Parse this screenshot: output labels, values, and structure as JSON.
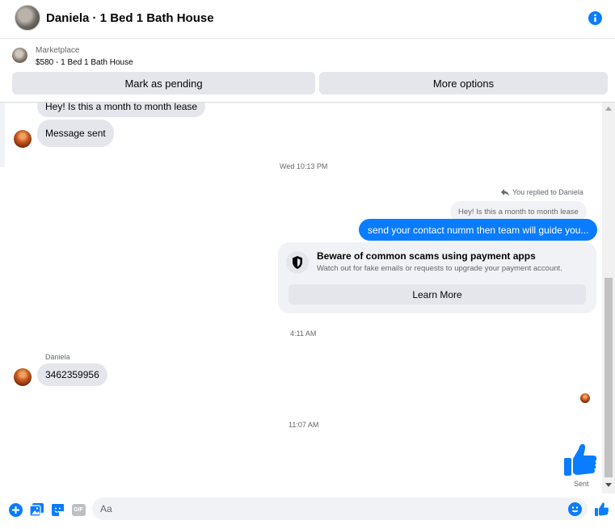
{
  "header": {
    "contact_name_title": "Daniela · 1 Bed 1 Bath House",
    "avatar_icon": "profile-photo",
    "info_icon": "info-icon"
  },
  "marketplace": {
    "label": "Marketplace",
    "listing": "$580 - 1 Bed 1 Bath House",
    "mark_pending_label": "Mark as pending",
    "more_options_label": "More options"
  },
  "messages": {
    "incoming_1": "Hey! Is this a month to month lease",
    "incoming_2": "Message sent",
    "timestamp_1": "Wed 10:13 PM",
    "replied_to": "You replied to Daniela",
    "quoted": "Hey! Is this a month to month lease",
    "outgoing_1": "send your contact numm then team will guide you...",
    "scam_title": "Beware of common scams using payment apps",
    "scam_subtitle": "Watch out for fake emails or requests to upgrade your payment account.",
    "learn_more_label": "Learn More",
    "timestamp_2": "4:11 AM",
    "sender_name": "Daniela",
    "incoming_3": "3462359956",
    "timestamp_3": "11:07 AM",
    "sent_status": "Sent"
  },
  "composer": {
    "placeholder": "Aa",
    "gif_label": "GIF"
  },
  "colors": {
    "accent": "#0a7cff",
    "bubble_gray": "#e4e6eb",
    "muted_text": "#65676b"
  }
}
